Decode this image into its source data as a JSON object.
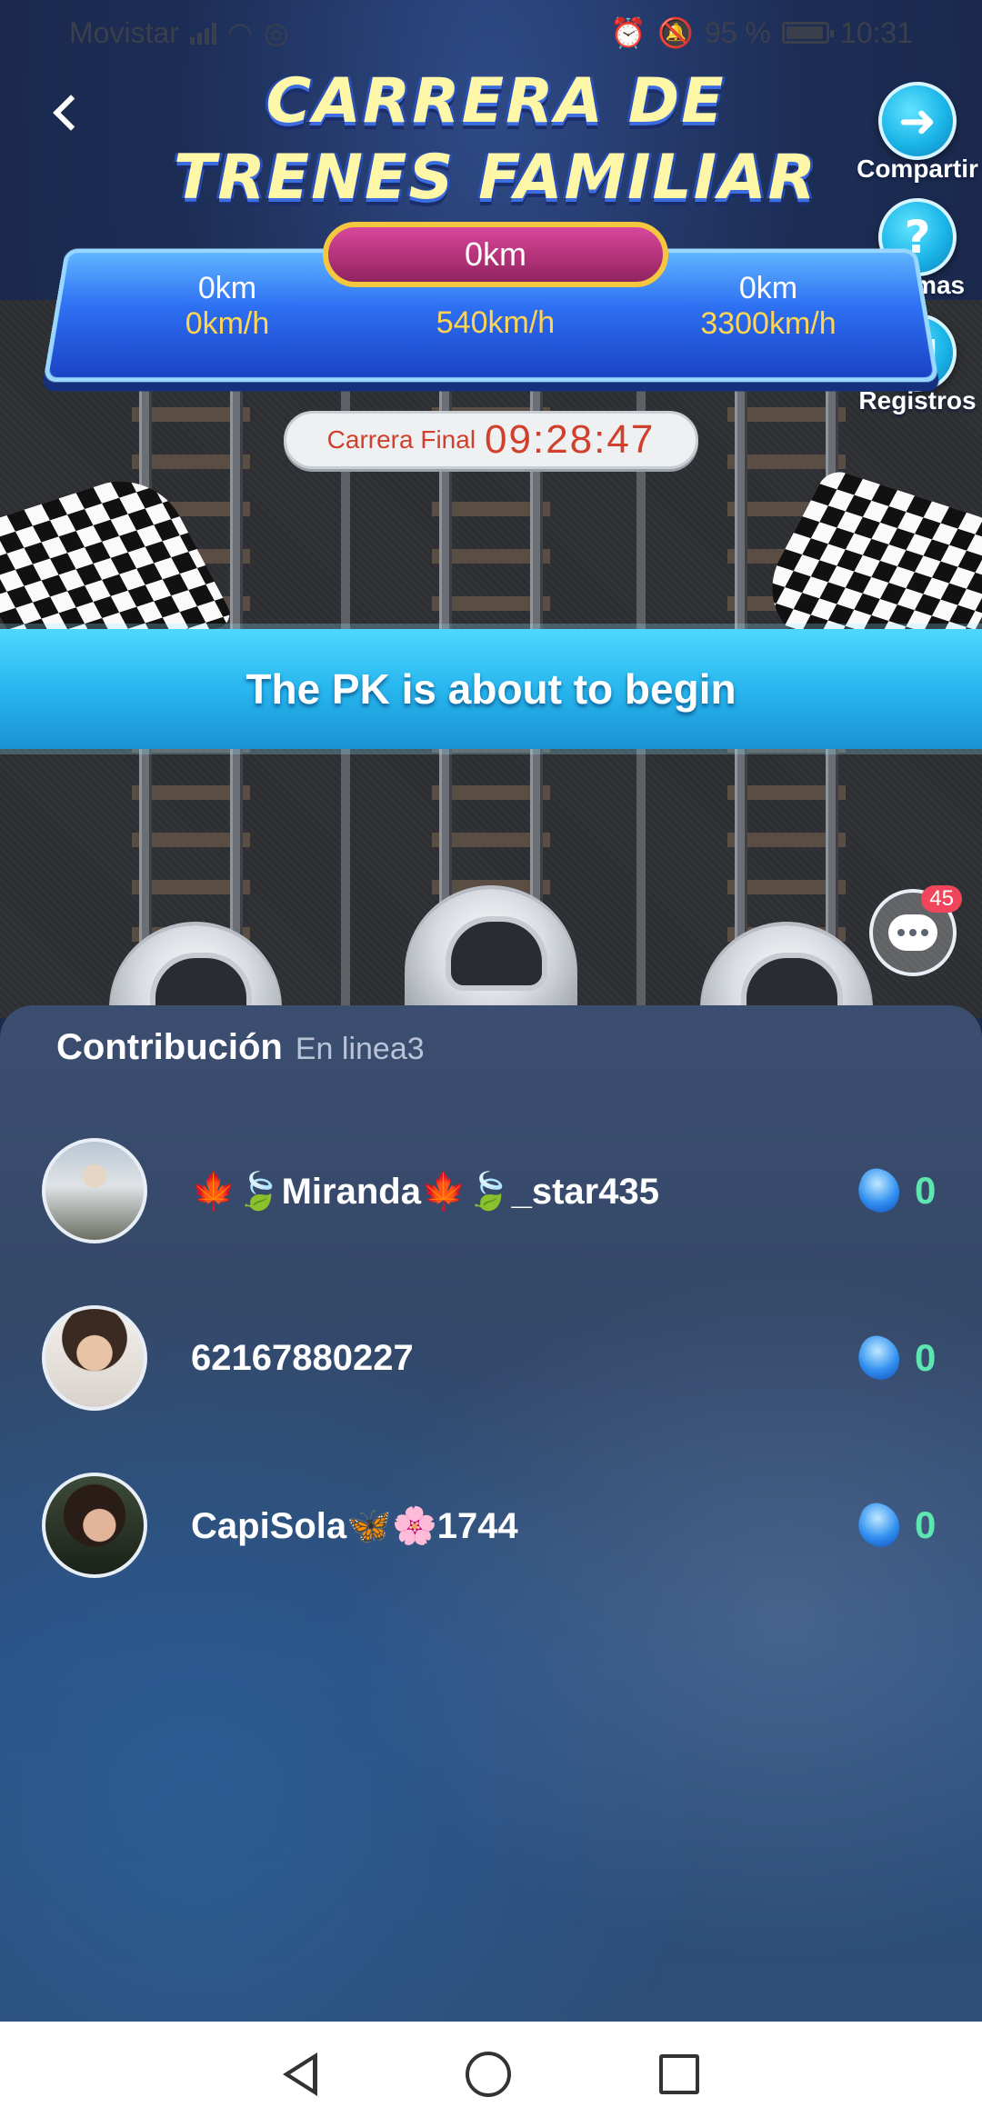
{
  "status_bar": {
    "carrier": "Movistar",
    "battery": "95 %",
    "time": "10:31"
  },
  "header": {
    "title_line1": "CARRERA DE",
    "title_line2": "TRENES FAMILIAR"
  },
  "side_buttons": {
    "share": "Compartir",
    "rules": "Normas",
    "records": "Registros"
  },
  "scoreboard": {
    "center_distance": "0km",
    "center_speed": "540km/h",
    "left_distance": "0km",
    "left_speed": "0km/h",
    "right_distance": "0km",
    "right_speed": "3300km/h"
  },
  "final_race": {
    "label": "Carrera Final",
    "countdown": "09:28:47"
  },
  "banner": {
    "text": "The PK is about to begin"
  },
  "chat": {
    "badge": "45"
  },
  "contribution": {
    "title": "Contribución",
    "subtitle": "En linea3",
    "rows": [
      {
        "name": "🍁🍃Miranda🍁🍃_star435",
        "score": "0"
      },
      {
        "name": "62167880227",
        "score": "0"
      },
      {
        "name": "CapiSola🦋🌸1744",
        "score": "0"
      }
    ]
  },
  "colors": {
    "accent_blue": "#27b6ee",
    "score_green": "#5ee6b0",
    "timer_red": "#d0402c",
    "pill_gold": "#f5c640"
  }
}
